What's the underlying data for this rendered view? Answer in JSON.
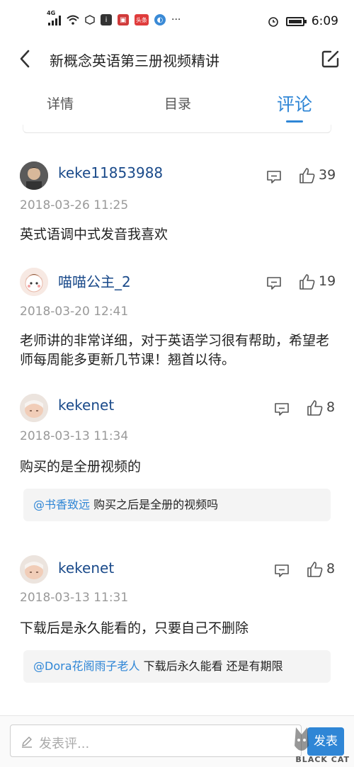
{
  "status_bar": {
    "network": "4G",
    "time": "6:09",
    "mini_icons": [
      "app-icon-a",
      "app-icon-b",
      "toutiao-icon",
      "app-icon-c"
    ],
    "toutiao_label": "头条",
    "more": "···"
  },
  "header": {
    "title": "新概念英语第三册视频精讲"
  },
  "tabs": [
    {
      "label": "详情"
    },
    {
      "label": "目录"
    },
    {
      "label": "评论"
    }
  ],
  "active_tab": "评论",
  "colors": {
    "accent": "#2f86d6",
    "username": "#1a4a8a",
    "date": "#999999"
  },
  "comments": [
    {
      "username": "keke11853988",
      "likes": "39",
      "date": "2018-03-26 11:25",
      "text": "英式语调中式发音我喜欢"
    },
    {
      "username": "喵喵公主_2",
      "likes": "19",
      "date": "2018-03-20 12:41",
      "text": "老师讲的非常详细，对于英语学习很有帮助，希望老师每周能多更新几节课！翘首以待。"
    },
    {
      "username": "kekenet",
      "likes": "8",
      "date": "2018-03-13 11:34",
      "text": "购买的是全册视频的",
      "quote_at": "@书香致远",
      "quote_text": " 购买之后是全册的视频吗"
    },
    {
      "username": "kekenet",
      "likes": "8",
      "date": "2018-03-13 11:31",
      "text": "下载后是永久能看的，只要自己不删除",
      "quote_at": "@Dora花阁雨子老人",
      "quote_text": " 下载后永久能看 还是有期限"
    }
  ],
  "bottom_bar": {
    "placeholder": "发表评...",
    "send_label": "发表",
    "watermark": "BLACK CAT"
  }
}
